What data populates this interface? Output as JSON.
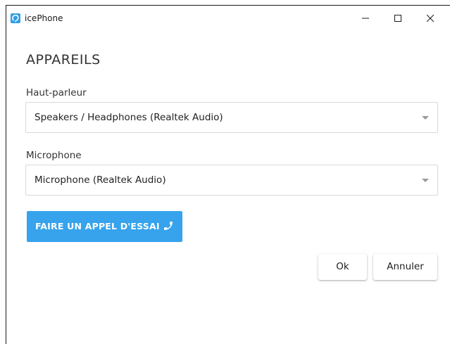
{
  "window": {
    "title": "icePhone"
  },
  "page": {
    "heading": "APPAREILS"
  },
  "speaker": {
    "label": "Haut-parleur",
    "selected": "Speakers / Headphones (Realtek Audio)"
  },
  "microphone": {
    "label": "Microphone",
    "selected": "Microphone (Realtek Audio)"
  },
  "test_call": {
    "label": "FAIRE UN APPEL D'ESSAI",
    "icon": "phone-icon",
    "color": "#36a3ec"
  },
  "actions": {
    "ok_label": "Ok",
    "cancel_label": "Annuler"
  },
  "colors": {
    "accent": "#36a3ec",
    "app_icon": "#2f9ee8"
  }
}
